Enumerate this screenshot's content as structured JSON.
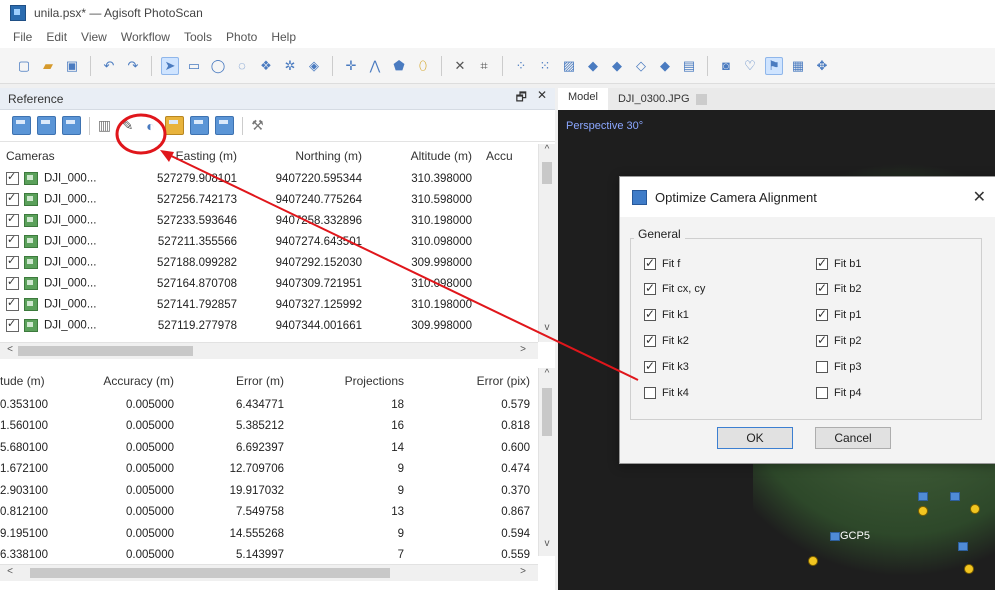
{
  "window": {
    "title": "unila.psx* — Agisoft PhotoScan"
  },
  "menu": [
    "File",
    "Edit",
    "View",
    "Workflow",
    "Tools",
    "Photo",
    "Help"
  ],
  "reference": {
    "title": "Reference",
    "pin_glyph": "🗗",
    "close_glyph": "✕",
    "cameras_table": {
      "headers": [
        "Cameras",
        "Easting (m)",
        "Northing (m)",
        "Altitude (m)",
        "Accu"
      ],
      "rows": [
        [
          "DJI_000...",
          "527279.908101",
          "9407220.595344",
          "310.398000"
        ],
        [
          "DJI_000...",
          "527256.742173",
          "9407240.775264",
          "310.598000"
        ],
        [
          "DJI_000...",
          "527233.593646",
          "9407258.332896",
          "310.198000"
        ],
        [
          "DJI_000...",
          "527211.355566",
          "9407274.643501",
          "310.098000"
        ],
        [
          "DJI_000...",
          "527188.099282",
          "9407292.152030",
          "309.998000"
        ],
        [
          "DJI_000...",
          "527164.870708",
          "9407309.721951",
          "310.098000"
        ],
        [
          "DJI_000...",
          "527141.792857",
          "9407327.125992",
          "310.198000"
        ],
        [
          "DJI_000...",
          "527119.277978",
          "9407344.001661",
          "309.998000"
        ]
      ]
    },
    "error_table": {
      "headers": [
        "tude (m)",
        "Accuracy (m)",
        "Error (m)",
        "Projections",
        "Error (pix)"
      ],
      "rows": [
        [
          "0.353100",
          "0.005000",
          "6.434771",
          "18",
          "0.579"
        ],
        [
          "1.560100",
          "0.005000",
          "5.385212",
          "16",
          "0.818"
        ],
        [
          "5.680100",
          "0.005000",
          "6.692397",
          "14",
          "0.600"
        ],
        [
          "1.672100",
          "0.005000",
          "12.709706",
          "9",
          "0.474"
        ],
        [
          "2.903100",
          "0.005000",
          "19.917032",
          "9",
          "0.370"
        ],
        [
          "0.812100",
          "0.005000",
          "7.549758",
          "13",
          "0.867"
        ],
        [
          "9.195100",
          "0.005000",
          "14.555268",
          "9",
          "0.594"
        ],
        [
          "6.338100",
          "0.005000",
          "5.143997",
          "7",
          "0.559"
        ]
      ]
    }
  },
  "view": {
    "tabs": [
      "Model",
      "DJI_0300.JPG"
    ],
    "perspective": "Perspective 30°",
    "gcp_label": "GCP5"
  },
  "dialog": {
    "title": "Optimize Camera Alignment",
    "close_glyph": "✕",
    "group": "General",
    "options_left": [
      {
        "label": "Fit f",
        "checked": true
      },
      {
        "label": "Fit cx, cy",
        "checked": true
      },
      {
        "label": "Fit k1",
        "checked": true
      },
      {
        "label": "Fit k2",
        "checked": true
      },
      {
        "label": "Fit k3",
        "checked": true
      },
      {
        "label": "Fit k4",
        "checked": false
      }
    ],
    "options_right": [
      {
        "label": "Fit b1",
        "checked": true
      },
      {
        "label": "Fit b2",
        "checked": true
      },
      {
        "label": "Fit p1",
        "checked": true
      },
      {
        "label": "Fit p2",
        "checked": true
      },
      {
        "label": "Fit p3",
        "checked": false
      },
      {
        "label": "Fit p4",
        "checked": false
      }
    ],
    "ok_label": "OK",
    "cancel_label": "Cancel"
  },
  "scroll_glyphs": {
    "up": "^",
    "down": "v",
    "left": "<",
    "right": ">"
  },
  "colors": {
    "annotation": "#e0161b",
    "accent": "#3c7fd1"
  }
}
